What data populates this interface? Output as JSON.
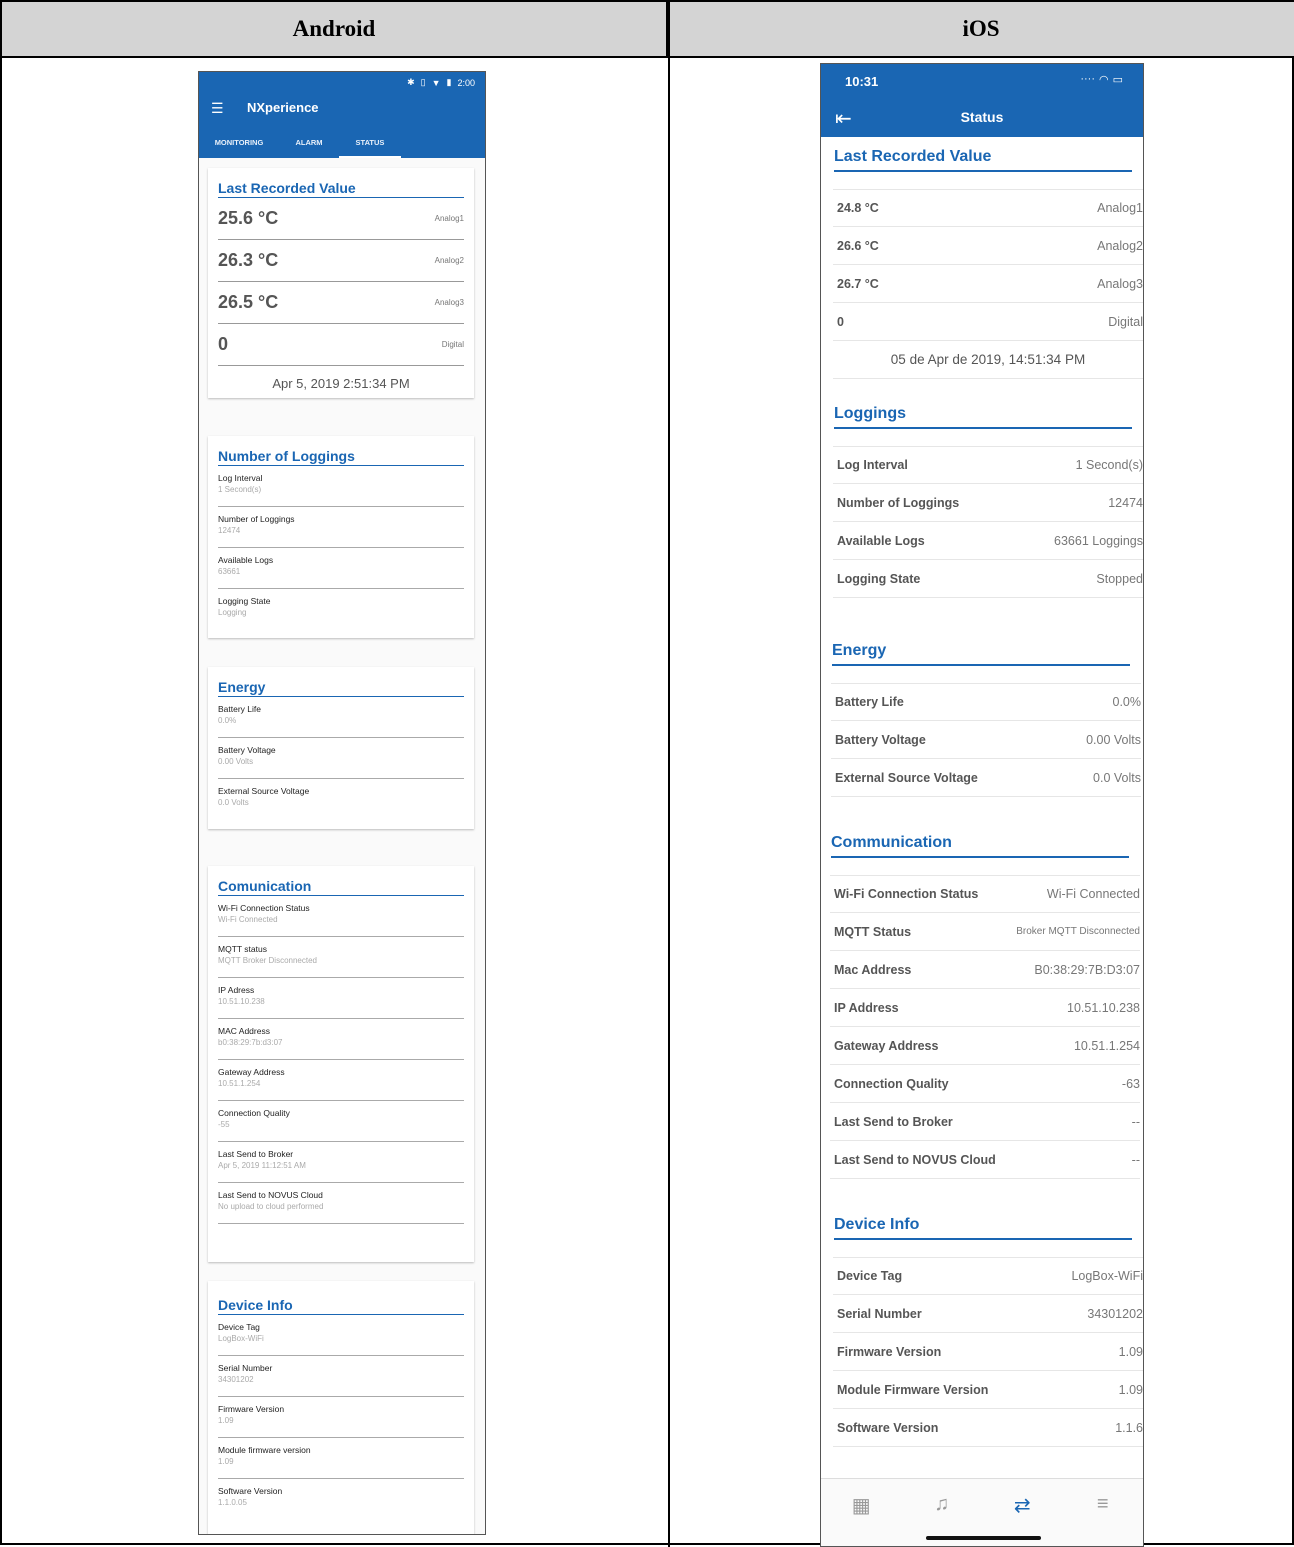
{
  "headers": {
    "android": "Android",
    "ios": "iOS"
  },
  "android": {
    "status_time": "2:00",
    "app_title": "NXperience",
    "tabs": [
      "MONITORING",
      "ALARM",
      "STATUS"
    ],
    "last_recorded": {
      "title": "Last Recorded Value",
      "rows": [
        {
          "value": "25.6 °C",
          "label": "Analog1"
        },
        {
          "value": "26.3 °C",
          "label": "Analog2"
        },
        {
          "value": "26.5 °C",
          "label": "Analog3"
        },
        {
          "value": "0",
          "label": "Digital"
        }
      ],
      "date": "Apr 5, 2019 2:51:34 PM"
    },
    "loggings": {
      "title": "Number of Loggings",
      "fields": [
        {
          "label": "Log Interval",
          "value": "1 Second(s)"
        },
        {
          "label": "Number of Loggings",
          "value": "12474"
        },
        {
          "label": "Available Logs",
          "value": "63661"
        },
        {
          "label": "Logging State",
          "value": "Logging"
        }
      ]
    },
    "energy": {
      "title": "Energy",
      "fields": [
        {
          "label": "Battery Life",
          "value": "0.0%"
        },
        {
          "label": "Battery Voltage",
          "value": "0.00 Volts"
        },
        {
          "label": "External Source Voltage",
          "value": "0.0 Volts"
        }
      ]
    },
    "communication": {
      "title": "Comunication",
      "fields": [
        {
          "label": "Wi-Fi Connection Status",
          "value": "Wi-Fi Connected"
        },
        {
          "label": "MQTT status",
          "value": "MQTT Broker Disconnected"
        },
        {
          "label": "IP Adress",
          "value": "10.51.10.238"
        },
        {
          "label": "MAC Address",
          "value": "b0:38:29:7b:d3:07"
        },
        {
          "label": "Gateway Address",
          "value": "10.51.1.254"
        },
        {
          "label": "Connection Quality",
          "value": "-55"
        },
        {
          "label": "Last Send to Broker",
          "value": "Apr 5, 2019 11:12:51 AM"
        },
        {
          "label": "Last Send to NOVUS Cloud",
          "value": "No upload to cloud performed"
        }
      ]
    },
    "device": {
      "title": "Device Info",
      "fields": [
        {
          "label": "Device Tag",
          "value": "LogBox-WiFi"
        },
        {
          "label": "Serial Number",
          "value": "34301202"
        },
        {
          "label": "Firmware Version",
          "value": "1.09"
        },
        {
          "label": "Module firmware version",
          "value": "1.09"
        },
        {
          "label": "Software Version",
          "value": "1.1.0.05"
        }
      ]
    }
  },
  "ios": {
    "status_time": "10:31",
    "title": "Status",
    "last_recorded": {
      "title": "Last Recorded Value",
      "rows": [
        {
          "key": "24.8 °C",
          "value": "Analog1"
        },
        {
          "key": "26.6 °C",
          "value": "Analog2"
        },
        {
          "key": "26.7 °C",
          "value": "Analog3"
        },
        {
          "key": "0",
          "value": "Digital"
        }
      ],
      "date": "05 de Apr de 2019, 14:51:34 PM"
    },
    "loggings": {
      "title": "Loggings",
      "rows": [
        {
          "key": "Log Interval",
          "value": "1 Second(s)"
        },
        {
          "key": "Number of Loggings",
          "value": "12474"
        },
        {
          "key": "Available Logs",
          "value": "63661 Loggings"
        },
        {
          "key": "Logging State",
          "value": "Stopped"
        }
      ]
    },
    "energy": {
      "title": "Energy",
      "rows": [
        {
          "key": "Battery Life",
          "value": "0.0%"
        },
        {
          "key": "Battery Voltage",
          "value": "0.00 Volts"
        },
        {
          "key": "External Source Voltage",
          "value": "0.0 Volts"
        }
      ]
    },
    "communication": {
      "title": "Communication",
      "rows": [
        {
          "key": "Wi-Fi Connection Status",
          "value": "Wi-Fi Connected"
        },
        {
          "key": "MQTT Status",
          "value": "Broker MQTT Disconnected"
        },
        {
          "key": "Mac Address",
          "value": "B0:38:29:7B:D3:07"
        },
        {
          "key": "IP Address",
          "value": "10.51.10.238"
        },
        {
          "key": "Gateway Address",
          "value": "10.51.1.254"
        },
        {
          "key": "Connection Quality",
          "value": "-63"
        },
        {
          "key": "Last Send to Broker",
          "value": "--"
        },
        {
          "key": "Last Send to NOVUS Cloud",
          "value": "--"
        }
      ]
    },
    "device": {
      "title": "Device Info",
      "rows": [
        {
          "key": "Device Tag",
          "value": "LogBox-WiFi"
        },
        {
          "key": "Serial Number",
          "value": "34301202"
        },
        {
          "key": "Firmware Version",
          "value": "1.09"
        },
        {
          "key": "Module Firmware Version",
          "value": "1.09"
        },
        {
          "key": "Software Version",
          "value": "1.1.6"
        }
      ]
    },
    "tabbar_icons": [
      "monitoring-icon",
      "alarm-bell-icon",
      "status-sync-icon",
      "menu-icon"
    ]
  }
}
